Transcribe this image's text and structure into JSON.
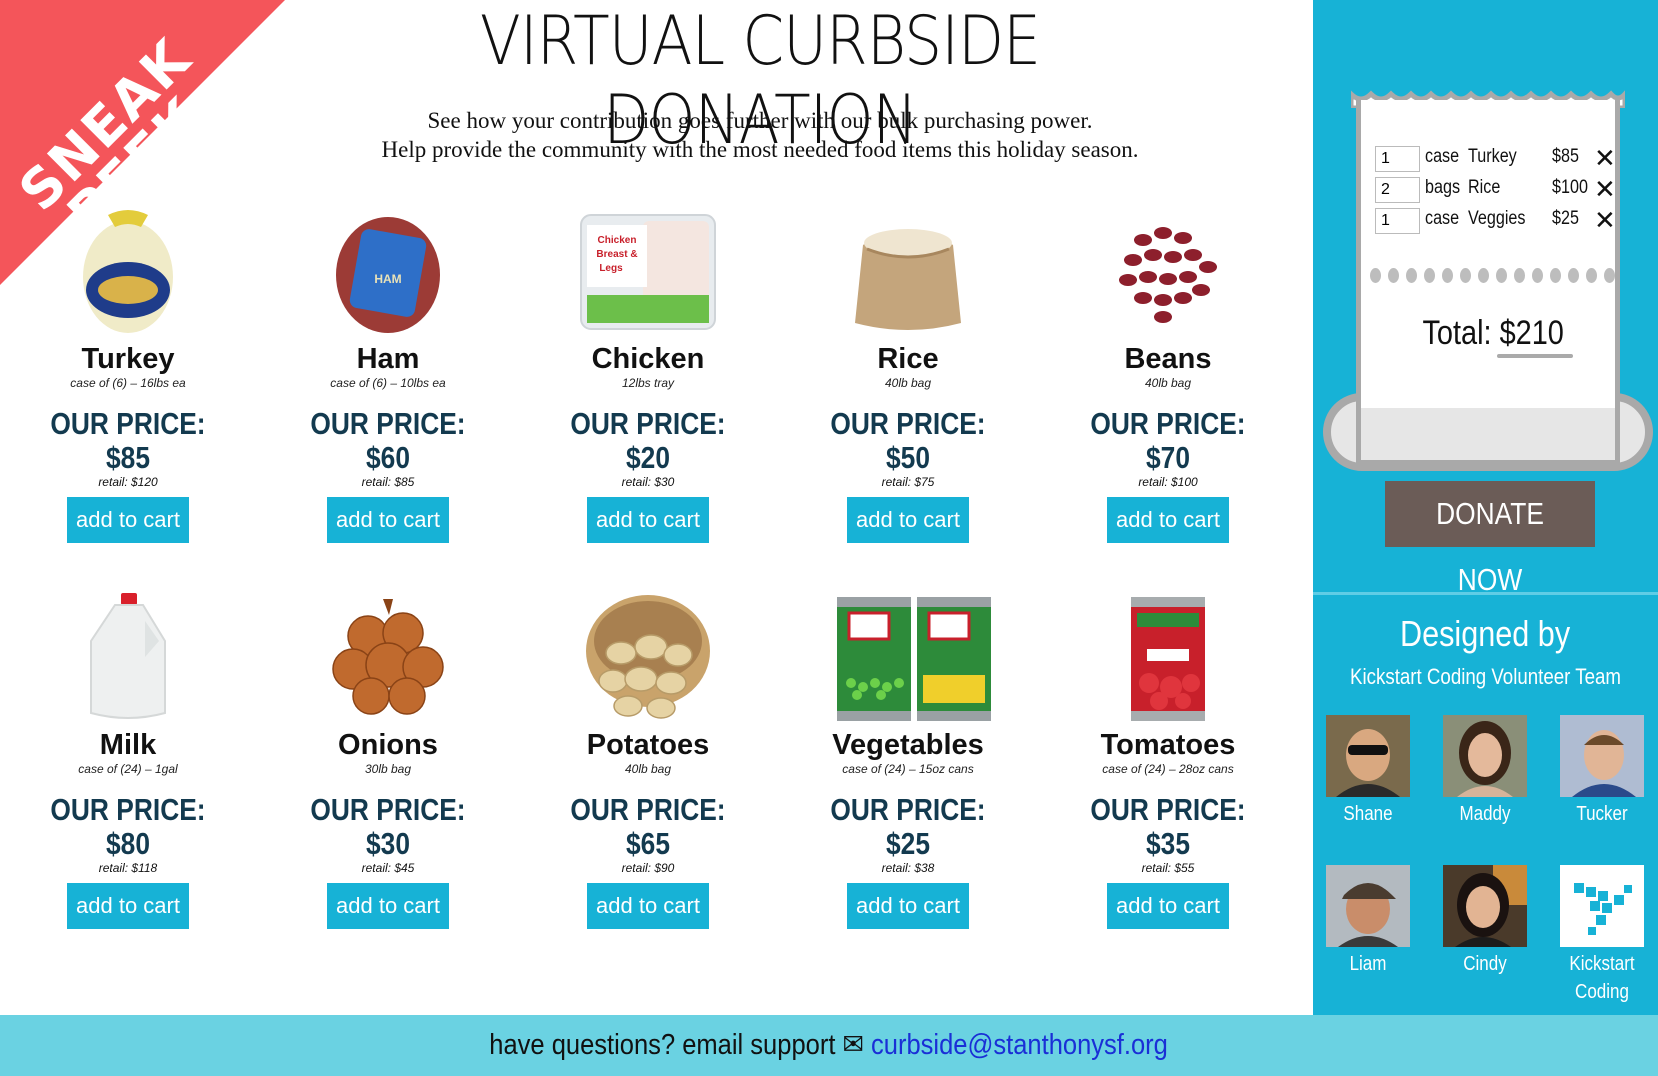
{
  "ribbon": {
    "line1": "SNEAK",
    "line2": "PEEK"
  },
  "header": {
    "title": "VIRTUAL CURBSIDE DONATION",
    "subtitle_line1": "See how your contribution goes further with our bulk purchasing power.",
    "subtitle_line2": "Help provide the community with the most needed food items this holiday season."
  },
  "products": [
    {
      "name": "Turkey",
      "desc": "case of (6) – 16lbs ea",
      "price": "OUR PRICE: $85",
      "retail": "retail: $120",
      "button": "add to cart",
      "icon": "turkey-icon"
    },
    {
      "name": "Ham",
      "desc": "case of (6) – 10lbs ea",
      "price": "OUR PRICE: $60",
      "retail": "retail: $85",
      "button": "add to cart",
      "icon": "ham-icon"
    },
    {
      "name": "Chicken",
      "desc": "12lbs tray",
      "price": "OUR PRICE: $20",
      "retail": "retail: $30",
      "button": "add to cart",
      "icon": "chicken-icon",
      "pkg_label": "Chicken Breast & Legs"
    },
    {
      "name": "Rice",
      "desc": "40lb bag",
      "price": "OUR PRICE: $50",
      "retail": "retail: $75",
      "button": "add to cart",
      "icon": "rice-sack-icon"
    },
    {
      "name": "Beans",
      "desc": "40lb bag",
      "price": "OUR PRICE: $70",
      "retail": "retail: $100",
      "button": "add to cart",
      "icon": "beans-icon"
    },
    {
      "name": "Milk",
      "desc": "case of (24) – 1gal",
      "price": "OUR PRICE: $80",
      "retail": "retail: $118",
      "button": "add to cart",
      "icon": "milk-jug-icon"
    },
    {
      "name": "Onions",
      "desc": "30lb bag",
      "price": "OUR PRICE: $30",
      "retail": "retail: $45",
      "button": "add to cart",
      "icon": "onions-icon"
    },
    {
      "name": "Potatoes",
      "desc": "40lb bag",
      "price": "OUR PRICE: $65",
      "retail": "retail: $90",
      "button": "add to cart",
      "icon": "potatoes-icon"
    },
    {
      "name": "Vegetables",
      "desc": "case of (24) – 15oz cans",
      "price": "OUR PRICE: $25",
      "retail": "retail: $38",
      "button": "add to cart",
      "icon": "vegetable-cans-icon"
    },
    {
      "name": "Tomatoes",
      "desc": "case of (24) – 28oz cans",
      "price": "OUR PRICE: $35",
      "retail": "retail: $55",
      "button": "add to cart",
      "icon": "tomato-can-icon"
    }
  ],
  "cart": {
    "items": [
      {
        "qty": "1",
        "unit": "case",
        "item": "Turkey",
        "amount": "$85",
        "remove": "✕"
      },
      {
        "qty": "2",
        "unit": "bags",
        "item": "Rice",
        "amount": "$100",
        "remove": "✕"
      },
      {
        "qty": "1",
        "unit": "case",
        "item": "Veggies",
        "amount": "$25",
        "remove": "✕"
      }
    ],
    "total_label": "Total: ",
    "total_value": "$210",
    "donate_label": "DONATE NOW"
  },
  "credits": {
    "heading": "Designed by",
    "team": "Kickstart Coding Volunteer Team",
    "members": [
      {
        "name": "Shane",
        "icon": "avatar-photo"
      },
      {
        "name": "Maddy",
        "icon": "avatar-photo"
      },
      {
        "name": "Tucker",
        "icon": "avatar-photo"
      },
      {
        "name": "Liam",
        "icon": "avatar-photo"
      },
      {
        "name": "Cindy",
        "icon": "avatar-photo"
      },
      {
        "name": "Kickstart",
        "name2": "Coding",
        "icon": "kickstart-bird-logo"
      }
    ]
  },
  "footer": {
    "text": "have questions? email support ",
    "email_icon": "✉",
    "email": "curbside@stanthonysf.org"
  },
  "colors": {
    "accent": "#17b2d6",
    "price": "#133a4f",
    "ribbon": "#f4555a",
    "donate": "#6b5c57",
    "footer": "#6ad2e2",
    "link": "#1a2fd6"
  }
}
